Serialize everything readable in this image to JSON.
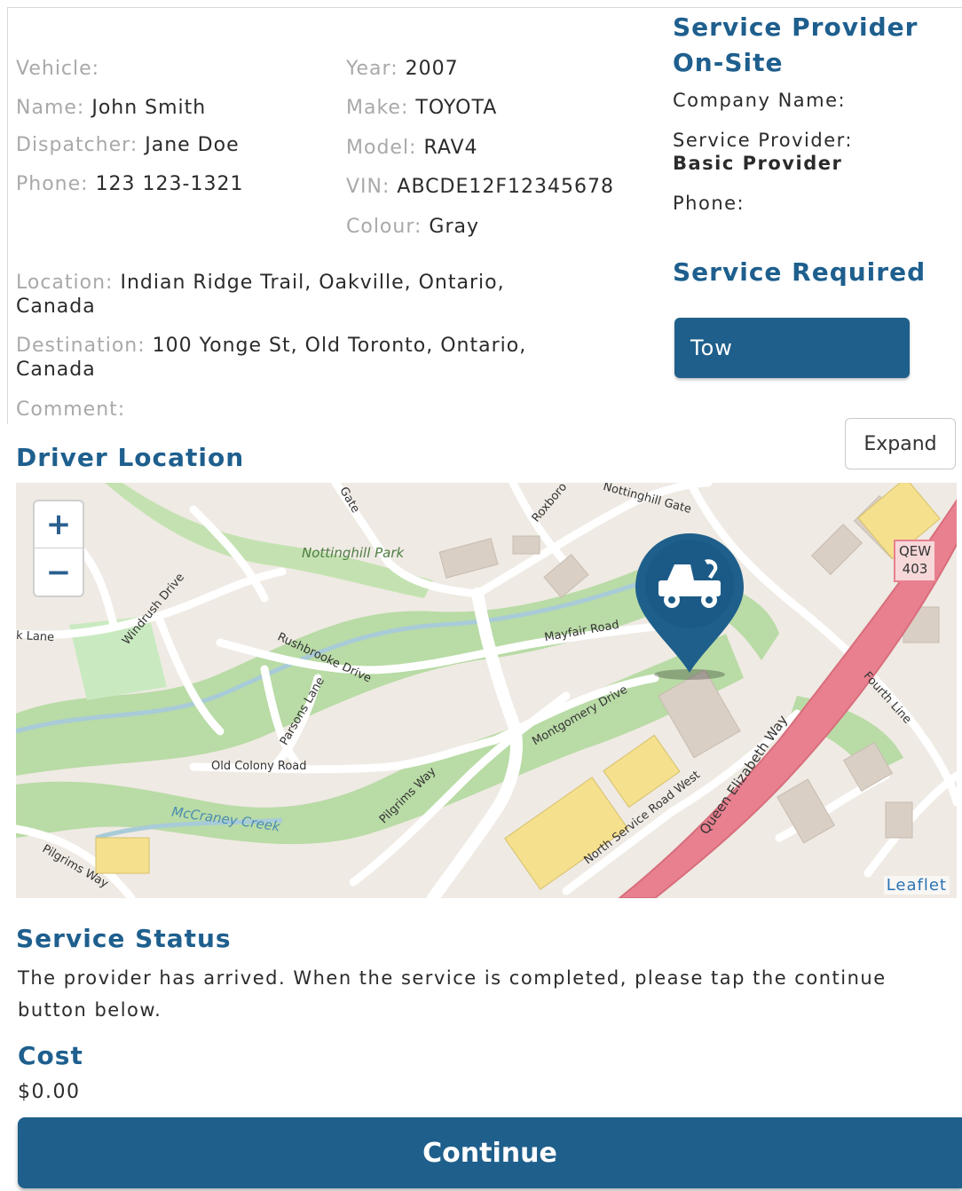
{
  "vehicle": {
    "label": "Vehicle:",
    "name_label": "Name:",
    "name": "John Smith",
    "dispatcher_label": "Dispatcher:",
    "dispatcher": "Jane Doe",
    "phone_label": "Phone:",
    "phone": "123 123-1321",
    "year_label": "Year:",
    "year": "2007",
    "make_label": "Make:",
    "make": "TOYOTA",
    "model_label": "Model:",
    "model": "RAV4",
    "vin_label": "VIN:",
    "vin": "ABCDE12F12345678",
    "colour_label": "Colour:",
    "colour": "Gray"
  },
  "trip": {
    "location_label": "Location:",
    "location": "Indian Ridge Trail, Oakville, Ontario, Canada",
    "destination_label": "Destination:",
    "destination": "100 Yonge St, Old Toronto, Ontario, Canada",
    "comment_label": "Comment:"
  },
  "provider": {
    "heading_line1": "Service Provider",
    "heading_line2": "On-Site",
    "company_label": "Company Name:",
    "provider_label": "Service Provider:",
    "provider_name": "Basic Provider",
    "phone_label": "Phone:"
  },
  "service_required": {
    "heading": "Service Required",
    "button_label": "Tow"
  },
  "driver_location": {
    "heading": "Driver Location",
    "expand_label": "Expand",
    "zoom_in": "+",
    "zoom_out": "−",
    "attribution": "Leaflet",
    "streets": {
      "nottinghill_gate": "Nottinghill Gate",
      "nottinghill_park": "Nottinghill Park",
      "rushbrooke": "Rushbrooke Drive",
      "mayfair": "Mayfair Road",
      "windrush": "Windrush Drive",
      "parsons": "Parsons Lane",
      "old_colony": "Old Colony Road",
      "montgomery": "Montgomery Drive",
      "pilgrims": "Pilgrims Way",
      "pilgrims2": "Pilgrims Way",
      "mccraney": "McCraney Creek",
      "north_service": "North Service Road West",
      "qew": "Queen Elizabeth Way",
      "fourth_line": "Fourth Line",
      "lane": "k Lane",
      "roxboro": "Roxboro",
      "gate": "Gate",
      "qew_shield_1": "QEW",
      "qew_shield_2": "403"
    },
    "colors": {
      "road_major": "#e8808f",
      "park": "#b9dba6",
      "water": "#a8cbd8",
      "marker": "#1f5f8b"
    }
  },
  "status": {
    "heading": "Service Status",
    "message": "The provider has arrived. When the service is completed, please tap the continue button below."
  },
  "cost": {
    "heading": "Cost",
    "value": "$0.00"
  },
  "actions": {
    "continue_label": "Continue"
  }
}
